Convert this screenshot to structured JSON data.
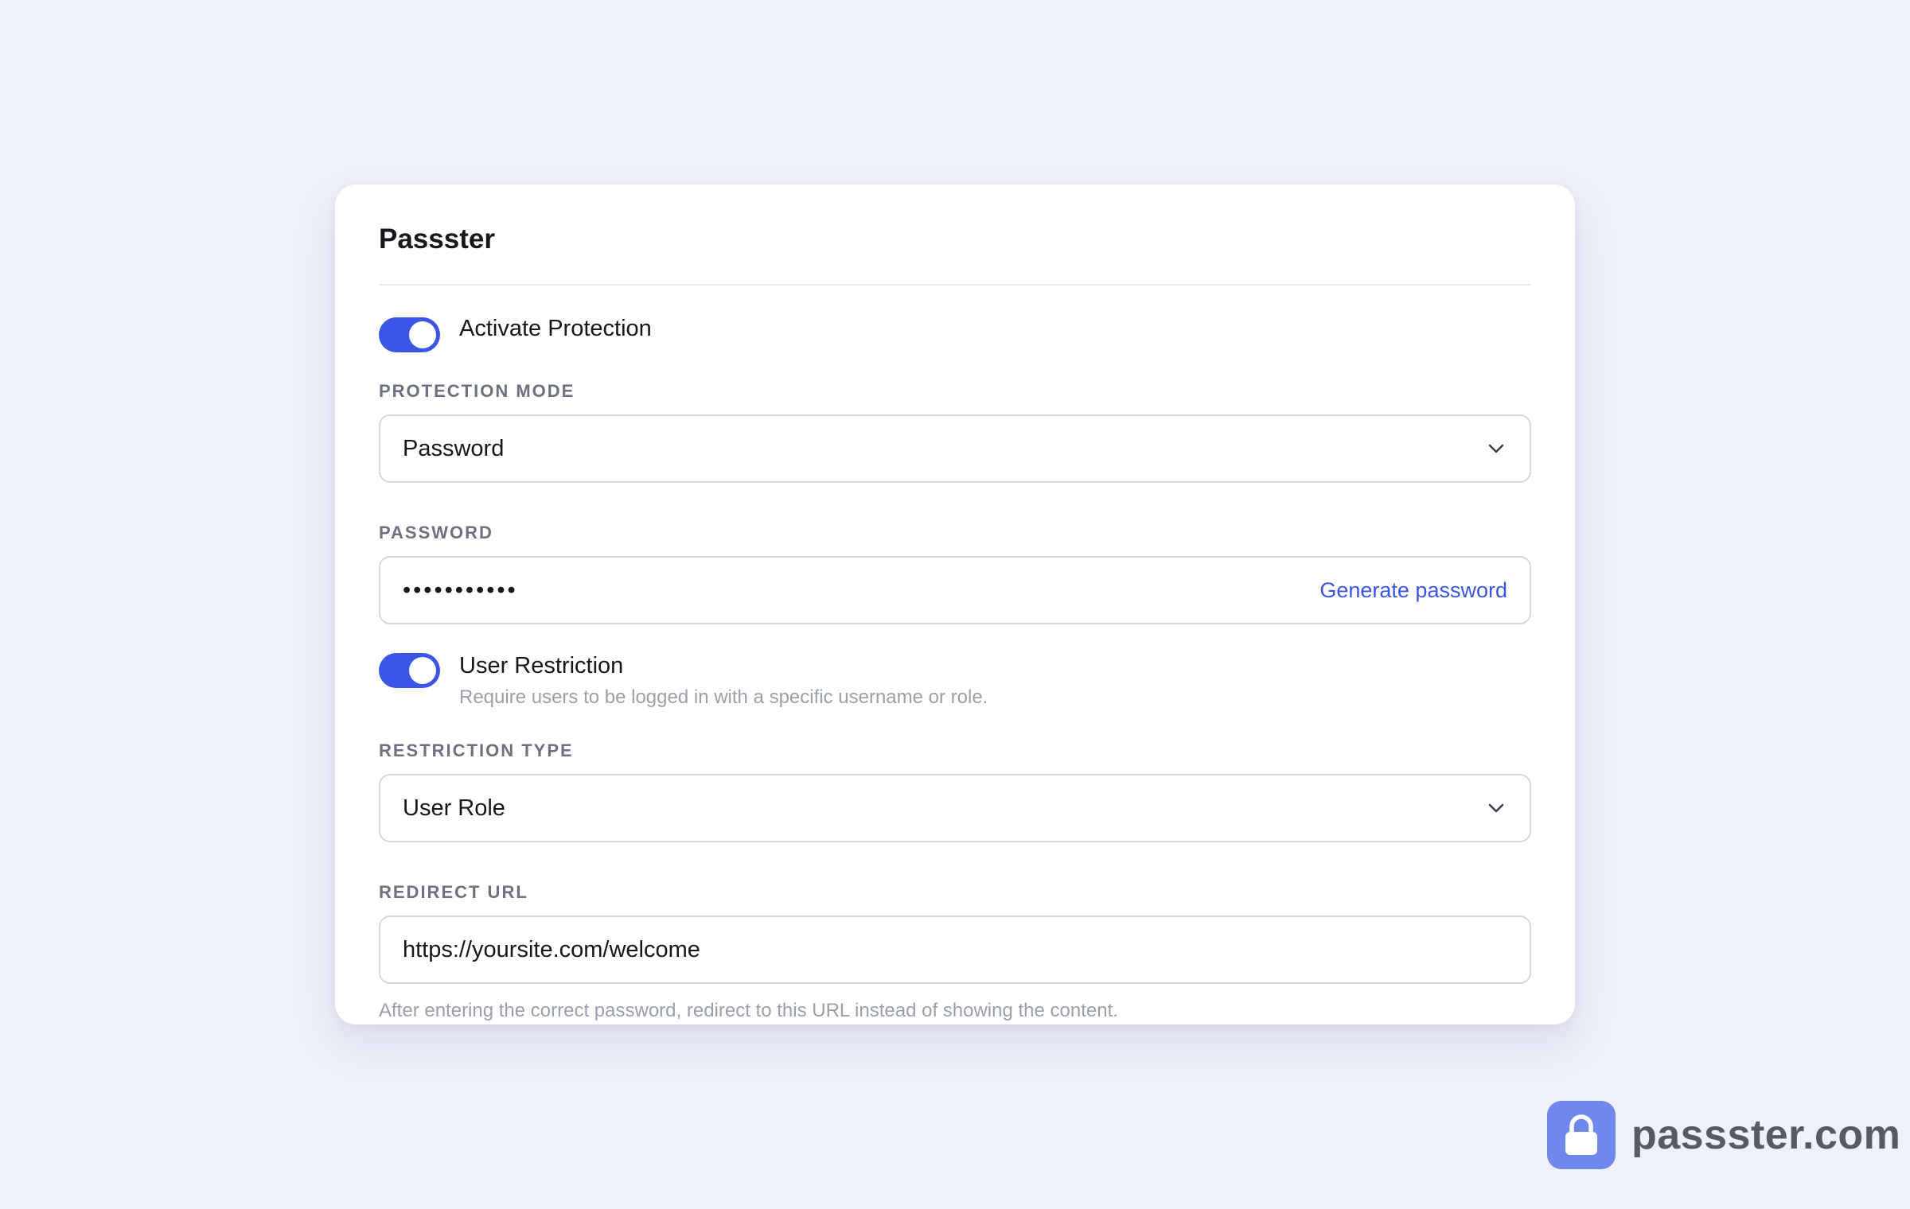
{
  "card": {
    "title": "Passster"
  },
  "activate_protection": {
    "label": "Activate Protection",
    "enabled": true
  },
  "protection_mode": {
    "label": "PROTECTION MODE",
    "selected": "Password",
    "icon": "chevron-down-icon"
  },
  "password": {
    "label": "PASSWORD",
    "masked_value": "•••••••••••",
    "generate_label": "Generate password"
  },
  "user_restriction": {
    "label": "User Restriction",
    "description": "Require users to be logged in with a specific username or role.",
    "enabled": true
  },
  "restriction_type": {
    "label": "RESTRICTION TYPE",
    "selected": "User Role",
    "icon": "chevron-down-icon"
  },
  "redirect_url": {
    "label": "REDIRECT URL",
    "value": "https://yoursite.com/welcome",
    "help": "After entering the correct password, redirect to this URL instead of showing the content."
  },
  "brand": {
    "text": "passster.com",
    "icon": "lock-icon"
  },
  "colors": {
    "accent": "#3b55e6",
    "background": "#eef0fa",
    "brand_logo": "#6f88ec"
  }
}
